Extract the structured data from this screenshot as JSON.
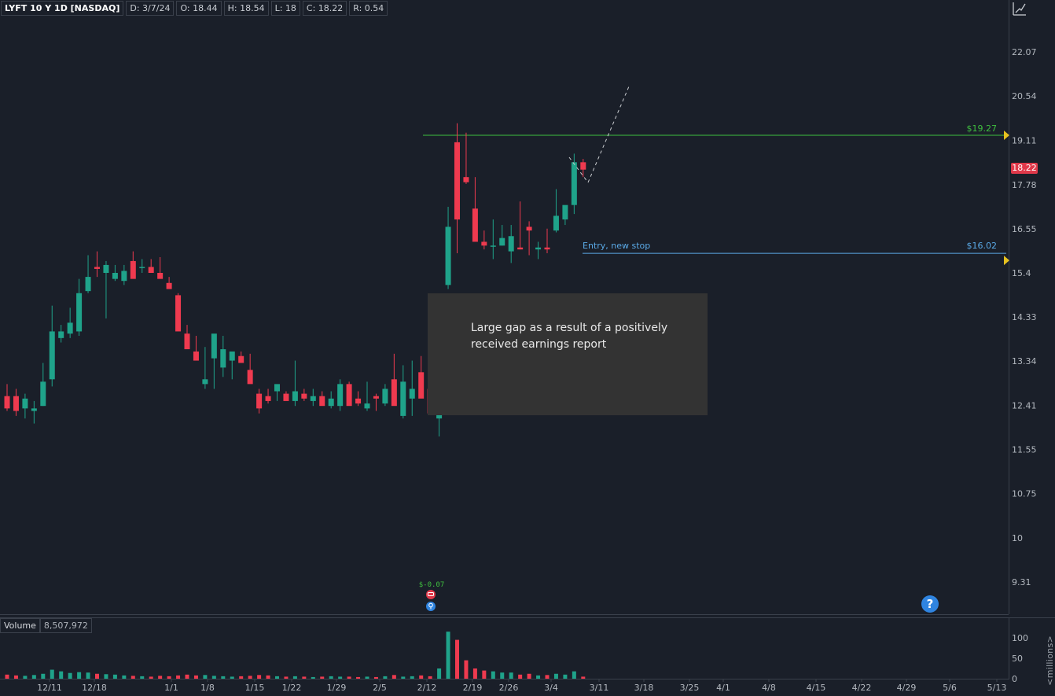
{
  "header": {
    "symbol": "LYFT 10 Y 1D [NASDAQ]",
    "date": "D: 3/7/24",
    "open": "O: 18.44",
    "high": "H: 18.54",
    "low": "L: 18",
    "close": "C: 18.22",
    "range": "R: 0.54"
  },
  "price_axis": {
    "labels": [
      "22.07",
      "20.54",
      "19.11",
      "17.78",
      "16.55",
      "15.4",
      "14.33",
      "13.34",
      "12.41",
      "11.55",
      "10.75",
      "10",
      "9.31"
    ],
    "current_price": "18.22"
  },
  "levels": {
    "resistance": {
      "label": "$19.27",
      "color": "#3fbf3f"
    },
    "entry": {
      "label": "$16.02",
      "text": "Entry, new stop",
      "color": "#5aa9e6"
    }
  },
  "annotation": {
    "text": "Large gap as a result of a positively received earnings report"
  },
  "events": {
    "earnings_label": "$-0.07",
    "earnings_icon": "phone-icon",
    "dividend_icon": "lightbulb-icon"
  },
  "volume": {
    "title": "Volume",
    "value": "8,507,972",
    "axis_labels": [
      "100",
      "50",
      "0"
    ],
    "unit": "<millions>"
  },
  "x_axis": {
    "labels": [
      "12/11",
      "12/18",
      "1/1",
      "1/8",
      "1/15",
      "1/22",
      "1/29",
      "2/5",
      "2/12",
      "2/19",
      "2/26",
      "3/4",
      "3/11",
      "3/18",
      "3/25",
      "4/1",
      "4/8",
      "4/15",
      "4/22",
      "4/29",
      "5/6",
      "5/13"
    ]
  },
  "colors": {
    "up": "#1fa38a",
    "down": "#ef3a4f",
    "background": "#1a1f29",
    "grid_border": "#3a404b"
  },
  "help": {
    "label": "?"
  },
  "chart_data": {
    "type": "candlestick",
    "symbol": "LYFT",
    "interval": "1D",
    "dates": [
      "12/4",
      "12/5",
      "12/6",
      "12/7",
      "12/8",
      "12/11",
      "12/12",
      "12/13",
      "12/14",
      "12/15",
      "12/18",
      "12/19",
      "12/20",
      "12/21",
      "12/22",
      "12/26",
      "12/27",
      "12/28",
      "12/29",
      "1/2",
      "1/3",
      "1/4",
      "1/5",
      "1/8",
      "1/9",
      "1/10",
      "1/11",
      "1/12",
      "1/16",
      "1/17",
      "1/18",
      "1/19",
      "1/22",
      "1/23",
      "1/24",
      "1/25",
      "1/26",
      "1/29",
      "1/30",
      "1/31",
      "2/1",
      "2/2",
      "2/5",
      "2/6",
      "2/7",
      "2/8",
      "2/9",
      "2/12",
      "2/13",
      "2/14",
      "2/15",
      "2/16",
      "2/20",
      "2/21",
      "2/22",
      "2/23",
      "2/26",
      "2/27",
      "2/28",
      "2/29",
      "3/1",
      "3/4",
      "3/5",
      "3/6",
      "3/7"
    ],
    "open": [
      12.6,
      12.6,
      12.35,
      12.3,
      12.4,
      12.95,
      13.85,
      13.95,
      14.0,
      14.95,
      15.55,
      15.4,
      15.25,
      15.2,
      15.7,
      15.55,
      15.55,
      15.4,
      15.15,
      14.85,
      13.95,
      13.55,
      12.85,
      13.4,
      13.2,
      13.35,
      13.45,
      13.15,
      12.65,
      12.6,
      12.7,
      12.65,
      12.5,
      12.65,
      12.5,
      12.6,
      12.4,
      12.4,
      12.85,
      12.55,
      12.35,
      12.6,
      12.45,
      12.95,
      12.2,
      12.55,
      13.1,
      12.75,
      12.15,
      15.1,
      19.05,
      18.0,
      17.1,
      16.2,
      16.1,
      16.1,
      15.95,
      16.05,
      16.6,
      16.0,
      16.05,
      16.5,
      16.8,
      17.2,
      18.44
    ],
    "high": [
      12.85,
      12.75,
      12.65,
      12.5,
      13.3,
      14.6,
      14.15,
      14.55,
      15.25,
      15.85,
      15.95,
      15.7,
      15.6,
      15.6,
      15.95,
      15.75,
      15.75,
      15.8,
      15.3,
      14.9,
      14.15,
      13.9,
      13.65,
      13.75,
      13.9,
      13.5,
      13.55,
      13.5,
      12.75,
      12.75,
      12.8,
      12.7,
      13.35,
      12.75,
      12.75,
      12.7,
      12.7,
      12.95,
      12.9,
      12.7,
      12.9,
      12.65,
      12.85,
      13.5,
      13.25,
      13.35,
      13.45,
      12.8,
      12.45,
      17.15,
      19.65,
      19.35,
      18.0,
      16.5,
      16.8,
      16.65,
      16.65,
      17.3,
      16.75,
      16.2,
      16.55,
      17.65,
      17.05,
      18.7,
      18.54
    ],
    "low": [
      12.3,
      12.2,
      12.15,
      12.05,
      12.4,
      12.8,
      13.75,
      13.85,
      13.9,
      14.9,
      15.3,
      14.3,
      15.2,
      15.1,
      15.4,
      15.4,
      15.45,
      15.3,
      15.05,
      14.8,
      13.75,
      13.45,
      12.75,
      12.75,
      13.0,
      12.95,
      13.4,
      12.9,
      12.25,
      12.45,
      12.5,
      12.55,
      12.4,
      12.5,
      12.4,
      12.55,
      12.35,
      12.3,
      12.7,
      12.4,
      12.3,
      12.3,
      12.4,
      12.45,
      12.15,
      12.2,
      12.75,
      12.4,
      11.8,
      15.0,
      15.9,
      17.8,
      17.05,
      16.0,
      15.75,
      16.1,
      15.65,
      16.0,
      15.85,
      15.75,
      15.9,
      16.45,
      16.65,
      16.95,
      18.0
    ],
    "close": [
      12.35,
      12.3,
      12.55,
      12.35,
      12.9,
      14.0,
      14.0,
      14.2,
      14.9,
      15.3,
      15.5,
      15.6,
      15.4,
      15.45,
      15.25,
      15.55,
      15.4,
      15.25,
      15.0,
      14.0,
      13.6,
      13.35,
      12.95,
      13.95,
      13.6,
      13.55,
      13.3,
      12.85,
      12.35,
      12.5,
      12.85,
      12.5,
      12.7,
      12.55,
      12.6,
      12.4,
      12.55,
      12.85,
      12.4,
      12.45,
      12.45,
      12.55,
      12.75,
      12.4,
      12.9,
      12.75,
      12.55,
      12.25,
      12.45,
      16.6,
      16.8,
      17.85,
      16.2,
      16.1,
      16.1,
      16.3,
      16.35,
      16.0,
      16.5,
      16.05,
      16.0,
      16.9,
      17.2,
      18.44,
      18.22
    ],
    "volume": [
      10,
      8,
      7,
      9,
      12,
      22,
      18,
      14,
      16,
      15,
      12,
      11,
      10,
      8,
      7,
      6,
      5,
      7,
      6,
      8,
      10,
      8,
      9,
      7,
      6,
      5,
      6,
      7,
      9,
      8,
      6,
      5,
      6,
      5,
      4,
      5,
      6,
      5,
      5,
      4,
      5,
      4,
      6,
      9,
      5,
      6,
      8,
      6,
      25,
      115,
      95,
      45,
      25,
      20,
      18,
      15,
      15,
      10,
      12,
      8,
      9,
      12,
      10,
      18,
      5
    ],
    "ylim": [
      9.05,
      23.2
    ],
    "ylog": true,
    "resistance_level": 19.27,
    "entry_level": 16.02,
    "earnings_eps_surprise": -0.07
  }
}
